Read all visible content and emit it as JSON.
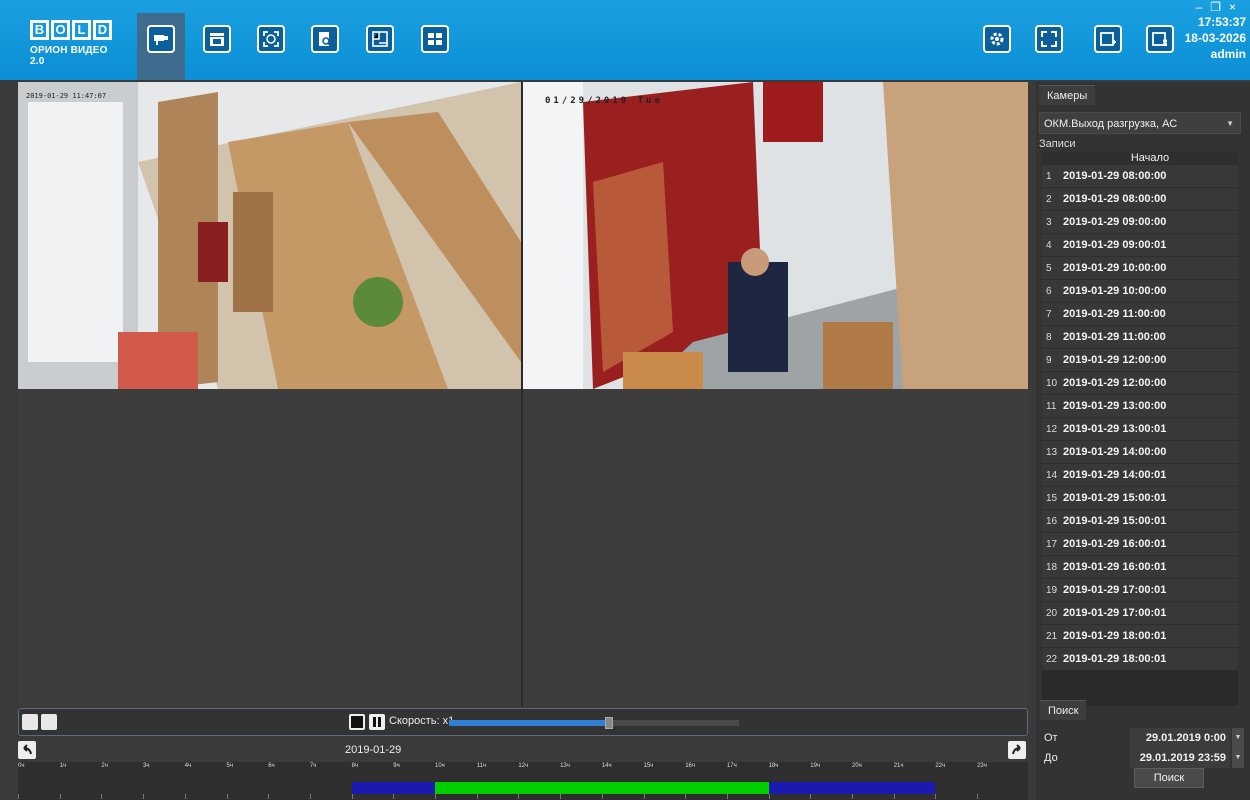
{
  "brand": {
    "logo_text": "BOLID",
    "product": "ОРИОН ВИДЕО 2.0"
  },
  "toolbar": {
    "left_icons": [
      "camera-icon",
      "clapperboard-icon",
      "face-recognition-icon",
      "document-search-icon",
      "map-plan-icon",
      "layout-grid-icon"
    ],
    "right_icons": [
      "gear-icon",
      "fullscreen-icon",
      "add-window-icon",
      "user-window-icon"
    ],
    "active_tab": "camera-icon"
  },
  "status": {
    "time": "17:53:37",
    "date": "18-03-2026",
    "user": "admin"
  },
  "window_controls": {
    "minimize": "–",
    "restore": "❐",
    "close": "×"
  },
  "video": {
    "cam1_osd": "2019-01-29 11:47:07",
    "cam2_osd": "01/29/2019 Tue"
  },
  "panel": {
    "cameras_tab": "Камеры",
    "camera_selected": "ОКМ.Выход разгрузка, АС",
    "records_label": "Записи",
    "records_header": "Начало",
    "records": [
      "2019-01-29 08:00:00",
      "2019-01-29 08:00:00",
      "2019-01-29 09:00:00",
      "2019-01-29 09:00:01",
      "2019-01-29 10:00:00",
      "2019-01-29 10:00:00",
      "2019-01-29 11:00:00",
      "2019-01-29 11:00:00",
      "2019-01-29 12:00:00",
      "2019-01-29 12:00:00",
      "2019-01-29 13:00:00",
      "2019-01-29 13:00:01",
      "2019-01-29 14:00:00",
      "2019-01-29 14:00:01",
      "2019-01-29 15:00:01",
      "2019-01-29 15:00:01",
      "2019-01-29 16:00:01",
      "2019-01-29 16:00:01",
      "2019-01-29 17:00:01",
      "2019-01-29 17:00:01",
      "2019-01-29 18:00:01",
      "2019-01-29 18:00:01"
    ],
    "search_tab": "Поиск",
    "from_label": "От",
    "from_value": "29.01.2019 0:00",
    "to_label": "До",
    "to_value": "29.01.2019 23:59",
    "search_button": "Поиск"
  },
  "controls": {
    "speed_label": "Скорость: x1",
    "speed_level": 0.55
  },
  "timeline": {
    "date": "2019-01-29",
    "hours": [
      "0ч",
      "1ч",
      "2ч",
      "3ч",
      "4ч",
      "5ч",
      "6ч",
      "7ч",
      "8ч",
      "9ч",
      "10ч",
      "11ч",
      "12ч",
      "13ч",
      "14ч",
      "15ч",
      "16ч",
      "17ч",
      "18ч",
      "19ч",
      "20ч",
      "21ч",
      "22ч",
      "23ч"
    ],
    "segments": [
      {
        "from": 8,
        "to": 10,
        "color": "#1a1ab0"
      },
      {
        "from": 10,
        "to": 18,
        "color": "#00d000"
      },
      {
        "from": 18,
        "to": 22,
        "color": "#1a1ab0"
      }
    ]
  }
}
